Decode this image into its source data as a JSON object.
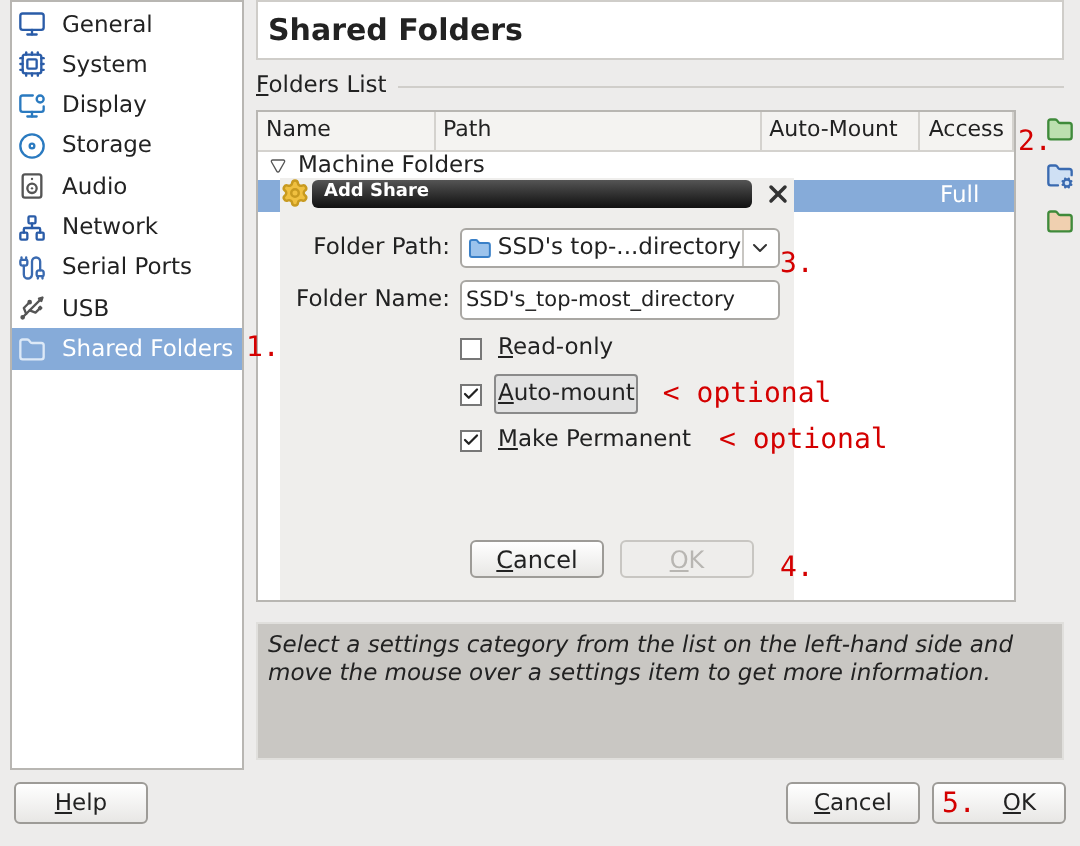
{
  "sidebar": {
    "items": [
      {
        "label": "General",
        "selected": false
      },
      {
        "label": "System",
        "selected": false
      },
      {
        "label": "Display",
        "selected": false
      },
      {
        "label": "Storage",
        "selected": false
      },
      {
        "label": "Audio",
        "selected": false
      },
      {
        "label": "Network",
        "selected": false
      },
      {
        "label": "Serial Ports",
        "selected": false
      },
      {
        "label": "USB",
        "selected": false
      },
      {
        "label": "Shared Folders",
        "selected": true
      }
    ]
  },
  "page_title": "Shared Folders",
  "folders_list": {
    "label": "Folders List",
    "columns": [
      "Name",
      "Path",
      "Auto-Mount",
      "Access"
    ],
    "groups": [
      {
        "label": "Machine Folders",
        "expanded": true,
        "rows": [
          {
            "access": "Full",
            "selected": true
          }
        ]
      }
    ]
  },
  "dialog": {
    "title": "Add Share",
    "folder_path": {
      "label": "Folder Path:",
      "value": "SSD's top-...directory"
    },
    "folder_name": {
      "label": "Folder Name:",
      "value": "SSD's_top-most_directory"
    },
    "checkboxes": [
      {
        "label": "Read-only",
        "checked": false,
        "focused": false
      },
      {
        "label": "Auto-mount",
        "checked": true,
        "focused": true,
        "note": "< optional"
      },
      {
        "label": "Make Permanent",
        "checked": true,
        "focused": false,
        "note": "< optional"
      }
    ],
    "buttons": [
      {
        "label": "Cancel",
        "disabled": false
      },
      {
        "label": "OK",
        "disabled": true
      }
    ]
  },
  "info": "Select a settings category from the list on the left-hand side and move the mouse over a settings item to get more information.",
  "buttons": [
    {
      "label": "Help"
    },
    {
      "label": "Cancel"
    },
    {
      "label": "OK"
    }
  ],
  "annotations": [
    "1.",
    "2.",
    "3.",
    "4.",
    "5."
  ]
}
